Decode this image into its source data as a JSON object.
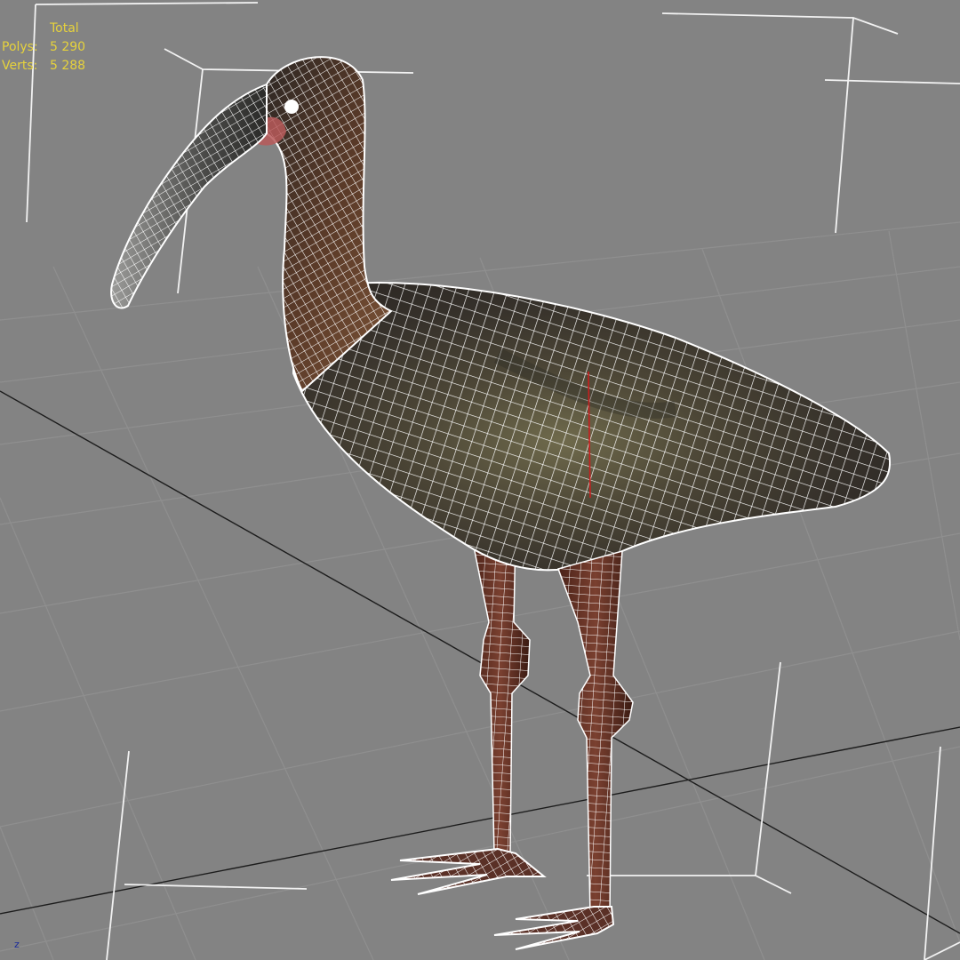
{
  "viewport": {
    "background": "#838383",
    "grid_color": "#8e8e8e",
    "world_axis_color": "#1c1c1c",
    "wire_color": "#ffffff",
    "axis_label": "z"
  },
  "stats": {
    "header": "Total",
    "polys_label": "Polys:",
    "polys_value": "5 290",
    "verts_label": "Verts:",
    "verts_value": "5 288",
    "text_color": "#e6d23c"
  },
  "model": {
    "subject": "ibis",
    "display": "smooth + wireframe"
  }
}
